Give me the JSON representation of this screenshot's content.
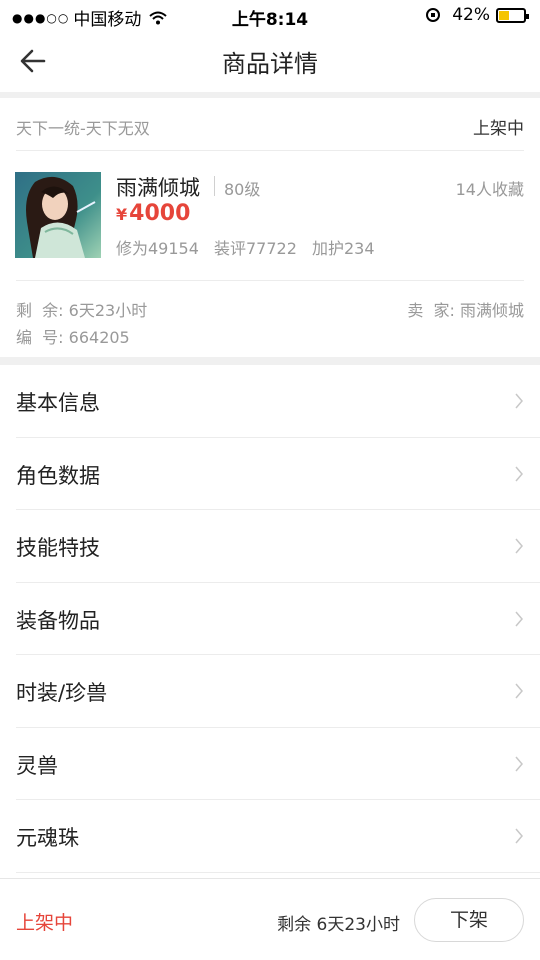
{
  "status_bar": {
    "carrier": "中国移动",
    "time": "上午8:14",
    "battery_percent": "42%",
    "battery_level": 0.42,
    "signal_icon": "signal-dots-icon",
    "wifi_icon": "wifi-icon"
  },
  "nav": {
    "title": "商品详情",
    "back_icon": "arrow-left-icon"
  },
  "product": {
    "server": "天下一统-天下无双",
    "status": "上架中",
    "name": "雨满倾城",
    "level": "80级",
    "favorites": "14人收藏",
    "currency": "¥",
    "price": "4000",
    "stats": [
      "修为49154",
      "装评77722",
      "加护234"
    ],
    "remaining": "剩  余: 6天23小时",
    "seller": "卖  家: 雨满倾城",
    "serial": "编  号: 664205"
  },
  "menu": {
    "items": [
      {
        "label": "基本信息"
      },
      {
        "label": "角色数据"
      },
      {
        "label": "技能特技"
      },
      {
        "label": "装备物品"
      },
      {
        "label": "时装/珍兽"
      },
      {
        "label": "灵兽"
      },
      {
        "label": "元魂珠"
      }
    ]
  },
  "bottom_bar": {
    "status": "上架中",
    "remaining": "剩余 6天23小时",
    "delist_button": "下架"
  },
  "colors": {
    "accent_red": "#e6453a",
    "battery_yellow": "#f5c400",
    "separator": "#f0f0f0"
  }
}
